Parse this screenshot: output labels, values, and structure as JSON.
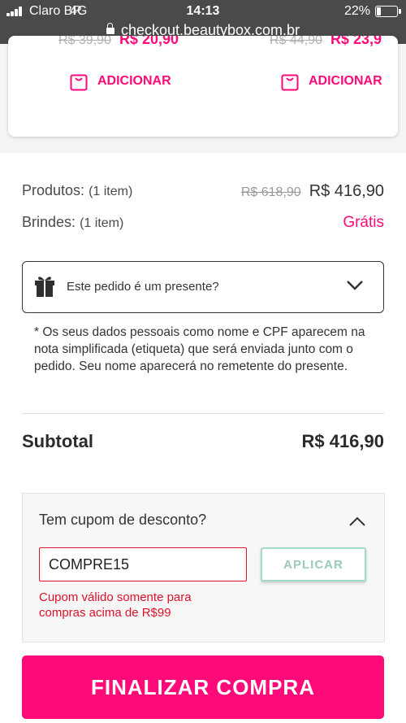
{
  "status_bar": {
    "carrier": "Claro BR",
    "network": "4G",
    "time": "14:13",
    "battery": "22%",
    "battery_level": 0.22,
    "url": "checkout.beautybox.com.br"
  },
  "product_cards": [
    {
      "old_price": "R$ 39,90",
      "price": "R$ 20,90",
      "add_label": "ADICIONAR"
    },
    {
      "old_price": "R$ 44,90",
      "price": "R$ 23,9",
      "add_label": "ADICIONAR"
    }
  ],
  "summary": {
    "products_label": "Produtos:",
    "products_count": "(1 item)",
    "products_old_price": "R$ 618,90",
    "products_price": "R$ 416,90",
    "gifts_label": "Brindes:",
    "gifts_count": "(1 item)",
    "gifts_price": "Grátis"
  },
  "gift_option": {
    "label": "Este pedido é um presente?",
    "note": "* Os seus dados pessoais como nome e CPF aparecem na nota simplificada (etiqueta) que será enviada junto com o pedido. Seu nome aparecerá no remetente do presente."
  },
  "subtotal": {
    "label": "Subtotal",
    "value": "R$ 416,90"
  },
  "coupon": {
    "title": "Tem cupom de desconto?",
    "input_value": "COMPRE15",
    "apply_label": "APLICAR",
    "error": "Cupom válido somente para compras acima de R$99"
  },
  "finalize_label": "FINALIZAR COMPRA",
  "colors": {
    "brand": "#ff0a78",
    "error": "#e0102a",
    "apply_border": "#a7d8cc",
    "status_bar": "#4a4a4a"
  }
}
